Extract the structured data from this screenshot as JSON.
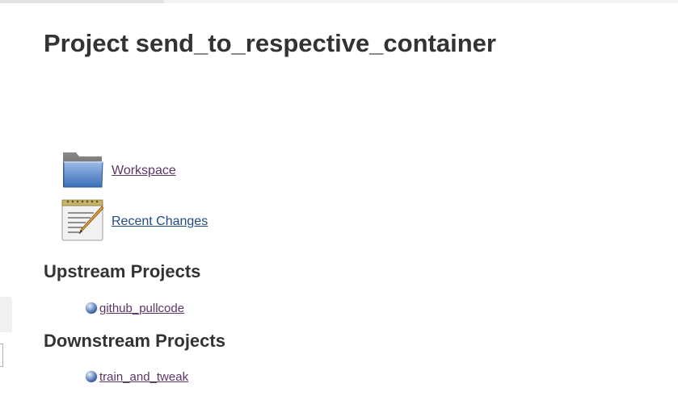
{
  "project": {
    "title": "Project send_to_respective_container"
  },
  "links": [
    {
      "label": "Workspace",
      "icon": "folder-icon"
    },
    {
      "label": "Recent Changes",
      "icon": "notepad-icon"
    }
  ],
  "upstream": {
    "heading": "Upstream Projects",
    "items": [
      {
        "label": "github_pullcode",
        "status_icon": "blue-ball-icon"
      }
    ]
  },
  "downstream": {
    "heading": "Downstream Projects",
    "items": [
      {
        "label": "train_and_tweak",
        "status_icon": "blue-ball-icon"
      }
    ]
  },
  "colors": {
    "text": "#333333",
    "visited_link": "#5c3566",
    "link": "#204a87",
    "status_blue": "#3a5f9e"
  }
}
